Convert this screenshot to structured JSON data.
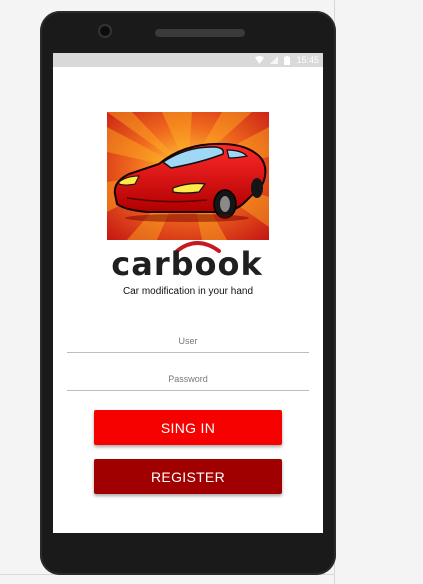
{
  "status_bar": {
    "time": "15:45",
    "icons": [
      "wifi-icon",
      "signal-icon",
      "battery-icon"
    ]
  },
  "app": {
    "brand": "carbook",
    "tagline": "Car modification in your hand"
  },
  "form": {
    "user_placeholder": "User",
    "password_placeholder": "Password",
    "signin_label": "SING IN",
    "register_label": "REGISTER"
  },
  "colors": {
    "signin": "#f70000",
    "register": "#a10000",
    "status_bar": "#d9d9d9",
    "phone_body": "#1a1a1a"
  }
}
